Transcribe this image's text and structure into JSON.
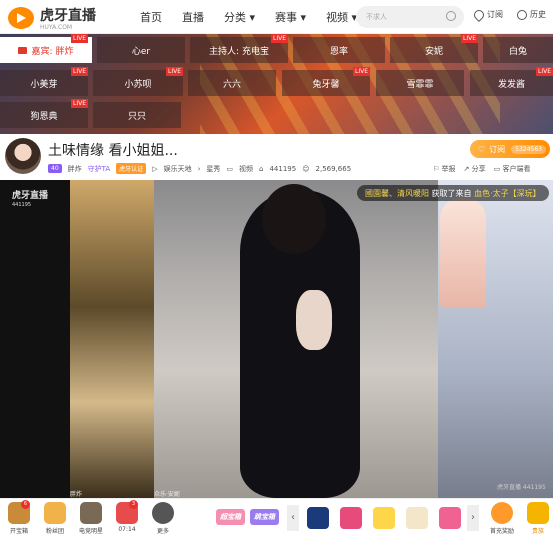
{
  "header": {
    "logo_text": "虎牙直播",
    "logo_sub": "HUYA.COM",
    "nav": [
      "首页",
      "直播",
      "分类",
      "赛事",
      "视频"
    ],
    "search_placeholder": "不求人",
    "subscribe_label": "订阅",
    "history_label": "历史"
  },
  "banner": {
    "guest_label": "嘉宾:",
    "guest_name": "胖炸",
    "live_tag": "LIVE",
    "chips": [
      {
        "label": "心er",
        "live": false
      },
      {
        "label": "主持人: 充电宝",
        "live": true
      },
      {
        "label": "恩率",
        "live": false
      },
      {
        "label": "安妮",
        "live": true
      },
      {
        "label": "白兔",
        "live": false
      },
      {
        "label": "小美芽",
        "live": true
      },
      {
        "label": "小苏呗",
        "live": true
      },
      {
        "label": "六六",
        "live": false
      },
      {
        "label": "兔牙馨",
        "live": true
      },
      {
        "label": "雪霏霏",
        "live": false
      },
      {
        "label": "发发酱",
        "live": true
      },
      {
        "label": "狗恩典",
        "live": true
      },
      {
        "label": "只只",
        "live": false
      }
    ]
  },
  "room": {
    "title": "土味情缘 看小姐姐...",
    "level": "40",
    "host_name": "胖炸",
    "host_tag": "守护TA",
    "cert": "虎牙认证",
    "category": "娱乐天地",
    "subcategory": "星秀",
    "video_label": "视频",
    "room_id": "441195",
    "viewers": "2,569,665",
    "report_label": "举报",
    "share_label": "分享",
    "client_label": "客户端看",
    "subscribe_button": "订阅",
    "subscribe_count": "5324563"
  },
  "player": {
    "watermark": "虎牙直播",
    "watermark_id": "441195",
    "announce_names": "國園馨、清风暖阳",
    "announce_text": "获取了来自",
    "announce_source": "血色·太子【深玩】",
    "left_label": "胖炸",
    "center_label": "众乐·安妮",
    "bottom_watermark": "虎牙直播 441195"
  },
  "toolbar": {
    "items": [
      {
        "label": "开宝箱",
        "badge": "6"
      },
      {
        "label": "粉丝团",
        "badge": ""
      },
      {
        "label": "电竞明星",
        "badge": ""
      },
      {
        "label": "07:14",
        "badge": "3"
      },
      {
        "label": "更多",
        "badge": ""
      }
    ],
    "promo1": "超宝箱",
    "promo2": "跳宝箱",
    "first_reward_label": "首充奖励",
    "treasure_label": "贵族",
    "prev_arrow": "‹",
    "next_arrow": "›"
  },
  "colors": {
    "accent": "#ff8c00",
    "live_red": "#e8302c",
    "announce_yellow": "#f6d54a"
  }
}
